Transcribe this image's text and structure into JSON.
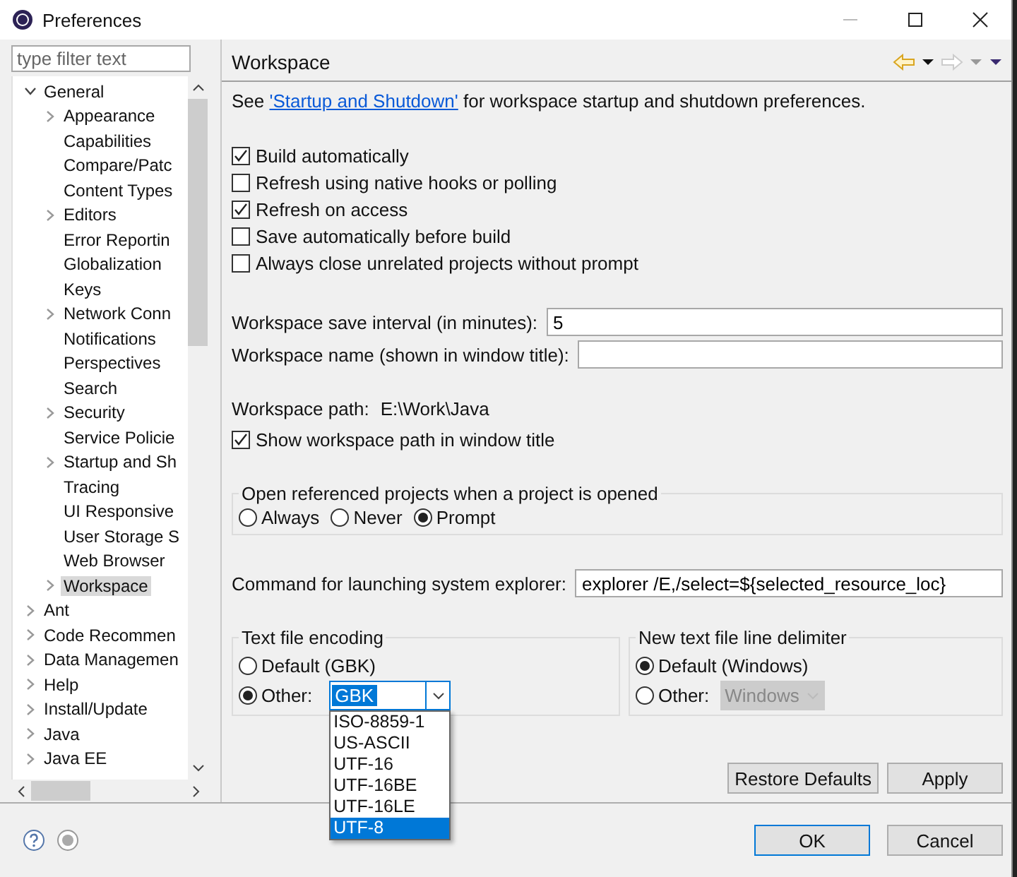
{
  "window": {
    "title": "Preferences"
  },
  "filter": {
    "placeholder": "type filter text"
  },
  "tree": [
    {
      "label": "General",
      "expanded": true,
      "selected": false,
      "children": [
        {
          "label": "Appearance",
          "expanded": false,
          "selected": false
        },
        {
          "label": "Capabilities",
          "selected": false
        },
        {
          "label": "Compare/Patc",
          "selected": false
        },
        {
          "label": "Content Types",
          "selected": false
        },
        {
          "label": "Editors",
          "expanded": false,
          "selected": false
        },
        {
          "label": "Error Reportin",
          "selected": false
        },
        {
          "label": "Globalization",
          "selected": false
        },
        {
          "label": "Keys",
          "selected": false
        },
        {
          "label": "Network Conn",
          "expanded": false,
          "selected": false
        },
        {
          "label": "Notifications",
          "selected": false
        },
        {
          "label": "Perspectives",
          "selected": false
        },
        {
          "label": "Search",
          "selected": false
        },
        {
          "label": "Security",
          "expanded": false,
          "selected": false
        },
        {
          "label": "Service Policie",
          "selected": false
        },
        {
          "label": "Startup and Sh",
          "expanded": false,
          "selected": false
        },
        {
          "label": "Tracing",
          "selected": false
        },
        {
          "label": "UI Responsive",
          "selected": false
        },
        {
          "label": "User Storage S",
          "selected": false
        },
        {
          "label": "Web Browser",
          "selected": false
        },
        {
          "label": "Workspace",
          "expanded": false,
          "selected": true
        }
      ]
    },
    {
      "label": "Ant",
      "expanded": false,
      "selected": false
    },
    {
      "label": "Code Recommen",
      "expanded": false,
      "selected": false
    },
    {
      "label": "Data Managemen",
      "expanded": false,
      "selected": false
    },
    {
      "label": "Help",
      "expanded": false,
      "selected": false
    },
    {
      "label": "Install/Update",
      "expanded": false,
      "selected": false
    },
    {
      "label": "Java",
      "expanded": false,
      "selected": false
    },
    {
      "label": "Java EE",
      "expanded": false,
      "selected": false
    }
  ],
  "page": {
    "title": "Workspace",
    "intro": {
      "before": "See ",
      "link": "'Startup and Shutdown'",
      "after": " for workspace startup and shutdown preferences."
    },
    "checkboxes": [
      {
        "label": "Build automatically",
        "checked": true
      },
      {
        "label": "Refresh using native hooks or polling",
        "checked": false
      },
      {
        "label": "Refresh on access",
        "checked": true
      },
      {
        "label": "Save automatically before build",
        "checked": false
      },
      {
        "label": "Always close unrelated projects without prompt",
        "checked": false
      }
    ],
    "fields": [
      {
        "label": "Workspace save interval (in minutes):",
        "value": "5"
      },
      {
        "label": "Workspace name (shown in window title):"
      }
    ],
    "path": {
      "label": "Workspace path:",
      "value": "E:\\Work\\Java"
    },
    "show_path": {
      "label": "Show workspace path in window title",
      "checked": true
    },
    "open_group": {
      "title": "Open referenced projects when a project is opened",
      "radios": [
        {
          "label": "Always",
          "selected": false
        },
        {
          "label": "Never",
          "selected": false
        },
        {
          "label": "Prompt",
          "selected": true
        }
      ]
    },
    "command": {
      "label": "Command for launching system explorer:",
      "value": "explorer /E,/select=${selected_resource_loc}"
    },
    "encoding": {
      "title": "Text file encoding",
      "radios": [
        {
          "label": "Default (GBK)",
          "selected": false
        },
        {
          "label": "Other:",
          "selected": true
        }
      ],
      "combo": {
        "value": "GBK",
        "disabled": false
      },
      "options": [
        {
          "label": "ISO-8859-1",
          "selected": false
        },
        {
          "label": "US-ASCII",
          "selected": false
        },
        {
          "label": "UTF-16",
          "selected": false
        },
        {
          "label": "UTF-16BE",
          "selected": false
        },
        {
          "label": "UTF-16LE",
          "selected": false
        },
        {
          "label": "UTF-8",
          "selected": true
        }
      ]
    },
    "delimiter": {
      "title": "New text file line delimiter",
      "radios": [
        {
          "label": "Default (Windows)",
          "selected": true
        },
        {
          "label": "Other:",
          "selected": false
        }
      ],
      "combo": {
        "value": "Windows",
        "disabled": true
      }
    },
    "buttons": [
      "Restore Defaults",
      "Apply"
    ]
  },
  "dialog_buttons": [
    {
      "label": "OK",
      "default": true
    },
    {
      "label": "Cancel",
      "default": false
    }
  ]
}
